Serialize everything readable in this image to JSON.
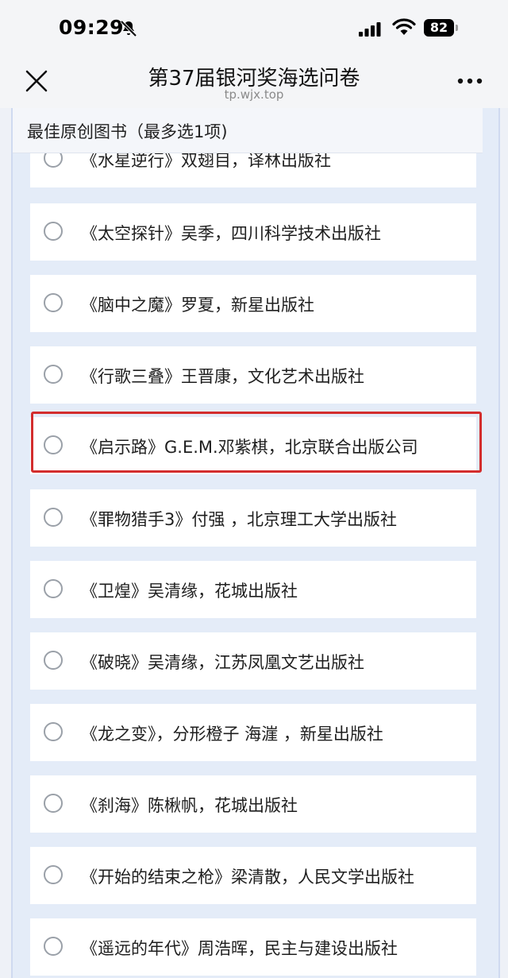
{
  "status_bar": {
    "time": "09:29",
    "battery": "82",
    "icons": [
      "mute-icon",
      "signal-icon",
      "wifi-icon",
      "battery-icon"
    ]
  },
  "nav": {
    "title": "第37届银河奖海选问卷",
    "url": "tp.wjx.top",
    "icons": [
      "close-icon",
      "more-icon"
    ]
  },
  "question": {
    "title": "最佳原创图书（最多选1项)"
  },
  "options": [
    {
      "label": "《水星逆行》双翅目，译林出版社"
    },
    {
      "label": "《太空探针》吴季，四川科学技术出版社"
    },
    {
      "label": "《脑中之魔》罗夏，新星出版社"
    },
    {
      "label": "《行歌三叠》王晋康，文化艺术出版社"
    },
    {
      "label": "《启示路》G.E.M.邓紫棋，北京联合出版公司"
    },
    {
      "label": "《罪物猎手3》付强 ，北京理工大学出版社"
    },
    {
      "label": "《卫煌》吴清缘，花城出版社"
    },
    {
      "label": "《破晓》吴清缘，江苏凤凰文艺出版社"
    },
    {
      "label": "《龙之变》，分形橙子 海漄 ，新星出版社"
    },
    {
      "label": "《刹海》陈楸帆，花城出版社"
    },
    {
      "label": "《开始的结束之枪》梁清散，人民文学出版社"
    },
    {
      "label": "《遥远的年代》周浩晖，民主与建设出版社"
    }
  ],
  "colors": {
    "highlight": "#d32d2d",
    "page_background": "#e4ecf8",
    "option_background": "#ffffff"
  }
}
